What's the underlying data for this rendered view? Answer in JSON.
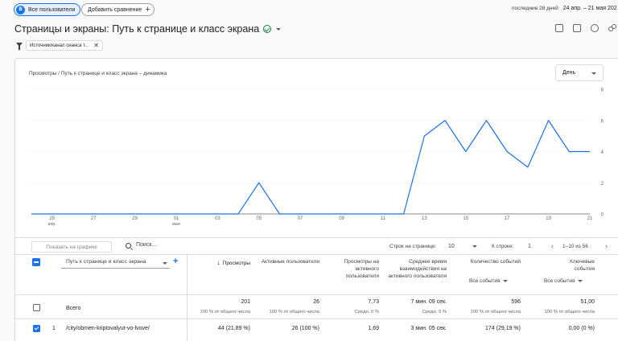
{
  "topbar": {
    "comparison_badge": "B",
    "comparison_label": "Все пользователи",
    "add_comparison_label": "Добавить сравнение",
    "add_icon": "+",
    "date_period": "последние 28 дней",
    "date_range": "24 апр. – 21 мая 202"
  },
  "header": {
    "title": "Страницы и экраны: Путь к странице и класс экрана"
  },
  "filter": {
    "chip_label": "Источник/канал сеанса т...",
    "remove_icon": "✕"
  },
  "chart": {
    "title": "Просмотры / Путь к странице и класс экрана – динамика",
    "granularity": "День"
  },
  "chart_data": {
    "type": "line",
    "x": [
      "24 апр.",
      "25 апр.",
      "26 апр.",
      "27 апр.",
      "28 апр.",
      "29 апр.",
      "30 апр.",
      "01 мая",
      "02 мая",
      "03 мая",
      "04 мая",
      "05 мая",
      "06 мая",
      "07 мая",
      "08 мая",
      "09 мая",
      "10 мая",
      "11 мая",
      "12 мая",
      "13 мая",
      "14 мая",
      "15 мая",
      "16 мая",
      "17 мая",
      "18 мая",
      "19 мая",
      "20 мая",
      "21 мая"
    ],
    "series": [
      {
        "values": [
          0,
          0,
          0,
          0,
          0,
          0,
          0,
          0,
          0,
          0,
          0,
          2,
          0,
          0,
          0,
          0,
          0,
          0,
          0,
          5,
          6,
          4,
          6,
          4,
          3,
          6,
          4,
          4
        ]
      }
    ],
    "x_tick_labels": [
      {
        "day": "25",
        "month": "апр."
      },
      {
        "day": "27",
        "month": ""
      },
      {
        "day": "29",
        "month": ""
      },
      {
        "day": "01",
        "month": "мая"
      },
      {
        "day": "03",
        "month": ""
      },
      {
        "day": "05",
        "month": ""
      },
      {
        "day": "07",
        "month": ""
      },
      {
        "day": "09",
        "month": ""
      },
      {
        "day": "11",
        "month": ""
      },
      {
        "day": "13",
        "month": ""
      },
      {
        "day": "15",
        "month": ""
      },
      {
        "day": "17",
        "month": ""
      },
      {
        "day": "19",
        "month": ""
      },
      {
        "day": "21",
        "month": ""
      }
    ],
    "y_ticks": [
      0,
      2,
      4,
      6,
      8
    ],
    "ylim": [
      0,
      8
    ],
    "grid": true,
    "color": "#1a73e8"
  },
  "toolbar": {
    "show_on_chart": "Показать на графике",
    "search_placeholder": "Поиск...",
    "rows_per_page_label": "Строк на странице:",
    "rows_per_page_value": "10",
    "to_row_label": "К строке:",
    "to_row_value": "1",
    "prev_icon": "‹",
    "next_icon": "›",
    "pagination": "1–10 из 56"
  },
  "table": {
    "dimension": "Путь к странице и класс экрана",
    "add_dimension_icon": "+",
    "columns": [
      {
        "label": "Просмотры",
        "sort_icon": "↓"
      },
      {
        "label": "Активные пользователи"
      },
      {
        "label": "Просмотры на активного пользователя"
      },
      {
        "label": "Среднее время взаимодействия на активного пользователя"
      },
      {
        "label": "Количество событий",
        "filter": "Все события"
      },
      {
        "label": "Ключевые события",
        "filter": "Все события"
      }
    ],
    "total": {
      "label": "Всего",
      "values": [
        "201",
        "26",
        "7,73",
        "7 мин. 09 сек.",
        "596",
        "51,00"
      ],
      "subs": [
        "100 % от общего числа",
        "100 % от общего числа",
        "Средн. 0 %",
        "Средн. 0 %",
        "100 % от общего числа",
        "100 % от общего числа"
      ]
    },
    "rows": [
      {
        "num": "1",
        "path": "/city/obmen-kriptovalyut-vo-lvove/",
        "values": [
          "44 (21,89 %)",
          "26 (100 %)",
          "1,69",
          "3 мин. 05 сек.",
          "174 (29,19 %)",
          "0,00 (0 %)"
        ]
      }
    ]
  }
}
